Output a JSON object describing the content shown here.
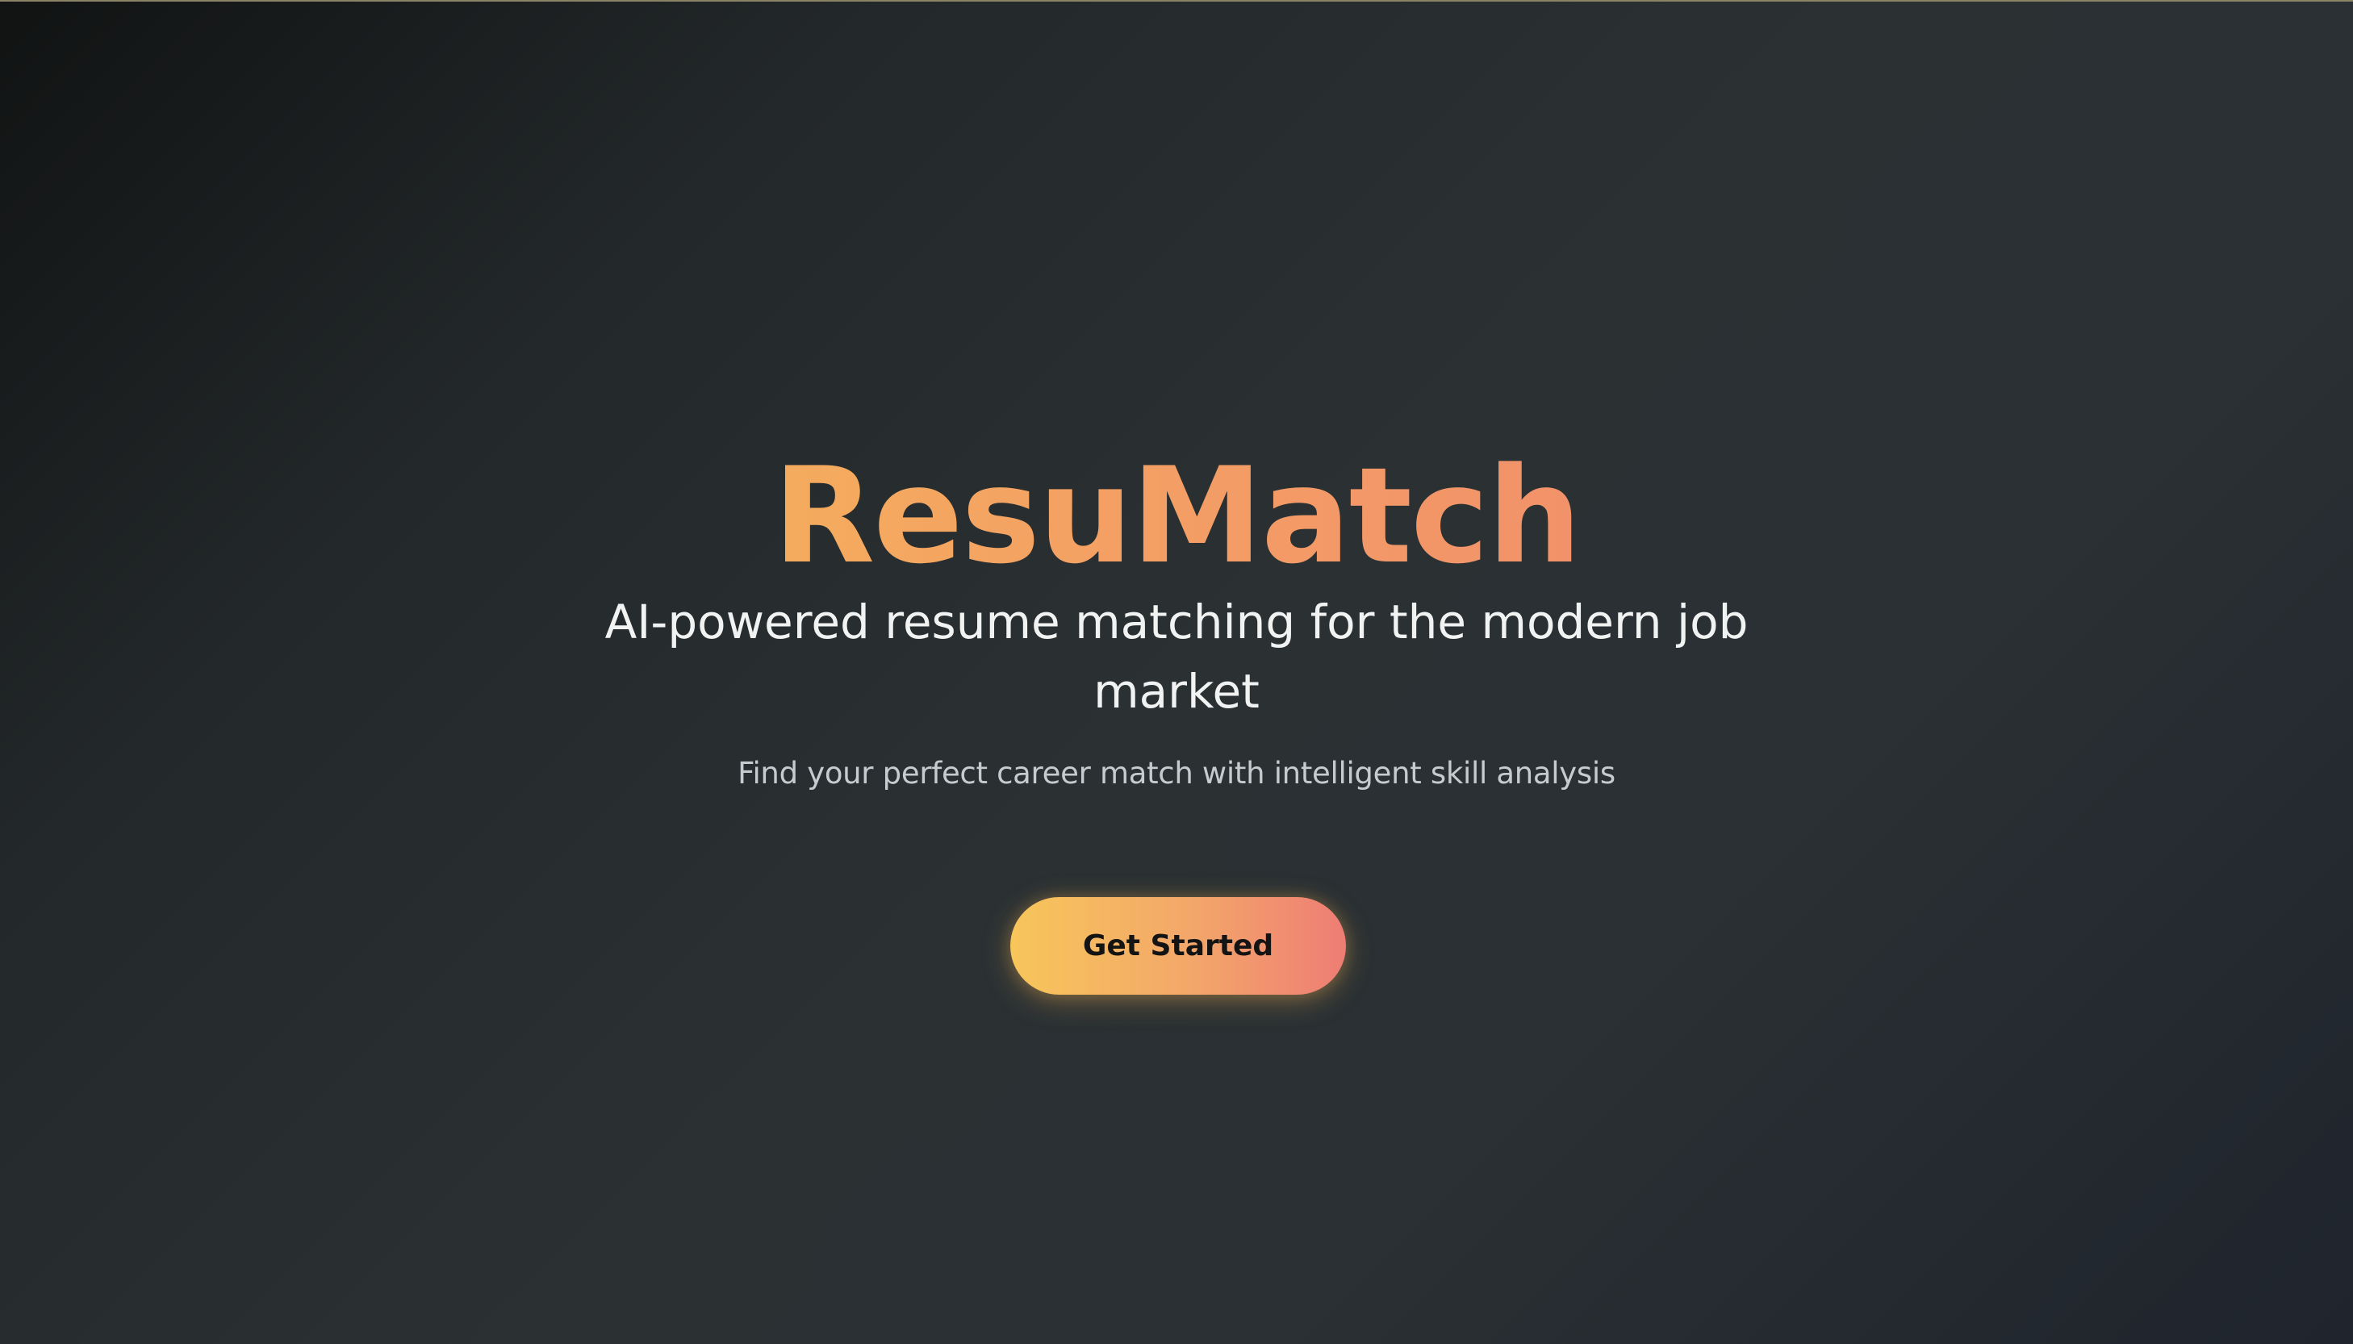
{
  "hero": {
    "brand_name": "ResuMatch",
    "headline": "AI-powered resume matching for the modern job market",
    "subheadline": "Find your perfect career match with intelligent skill analysis",
    "cta_label": "Get Started"
  },
  "colors": {
    "background_dark": "#111313",
    "background_mid": "#2b3133",
    "gradient_start": "#f7c650",
    "gradient_end": "#ef7c71",
    "headline_text": "#f1f2f2",
    "subheadline_text": "#c6cbcf",
    "button_text": "#141414"
  }
}
